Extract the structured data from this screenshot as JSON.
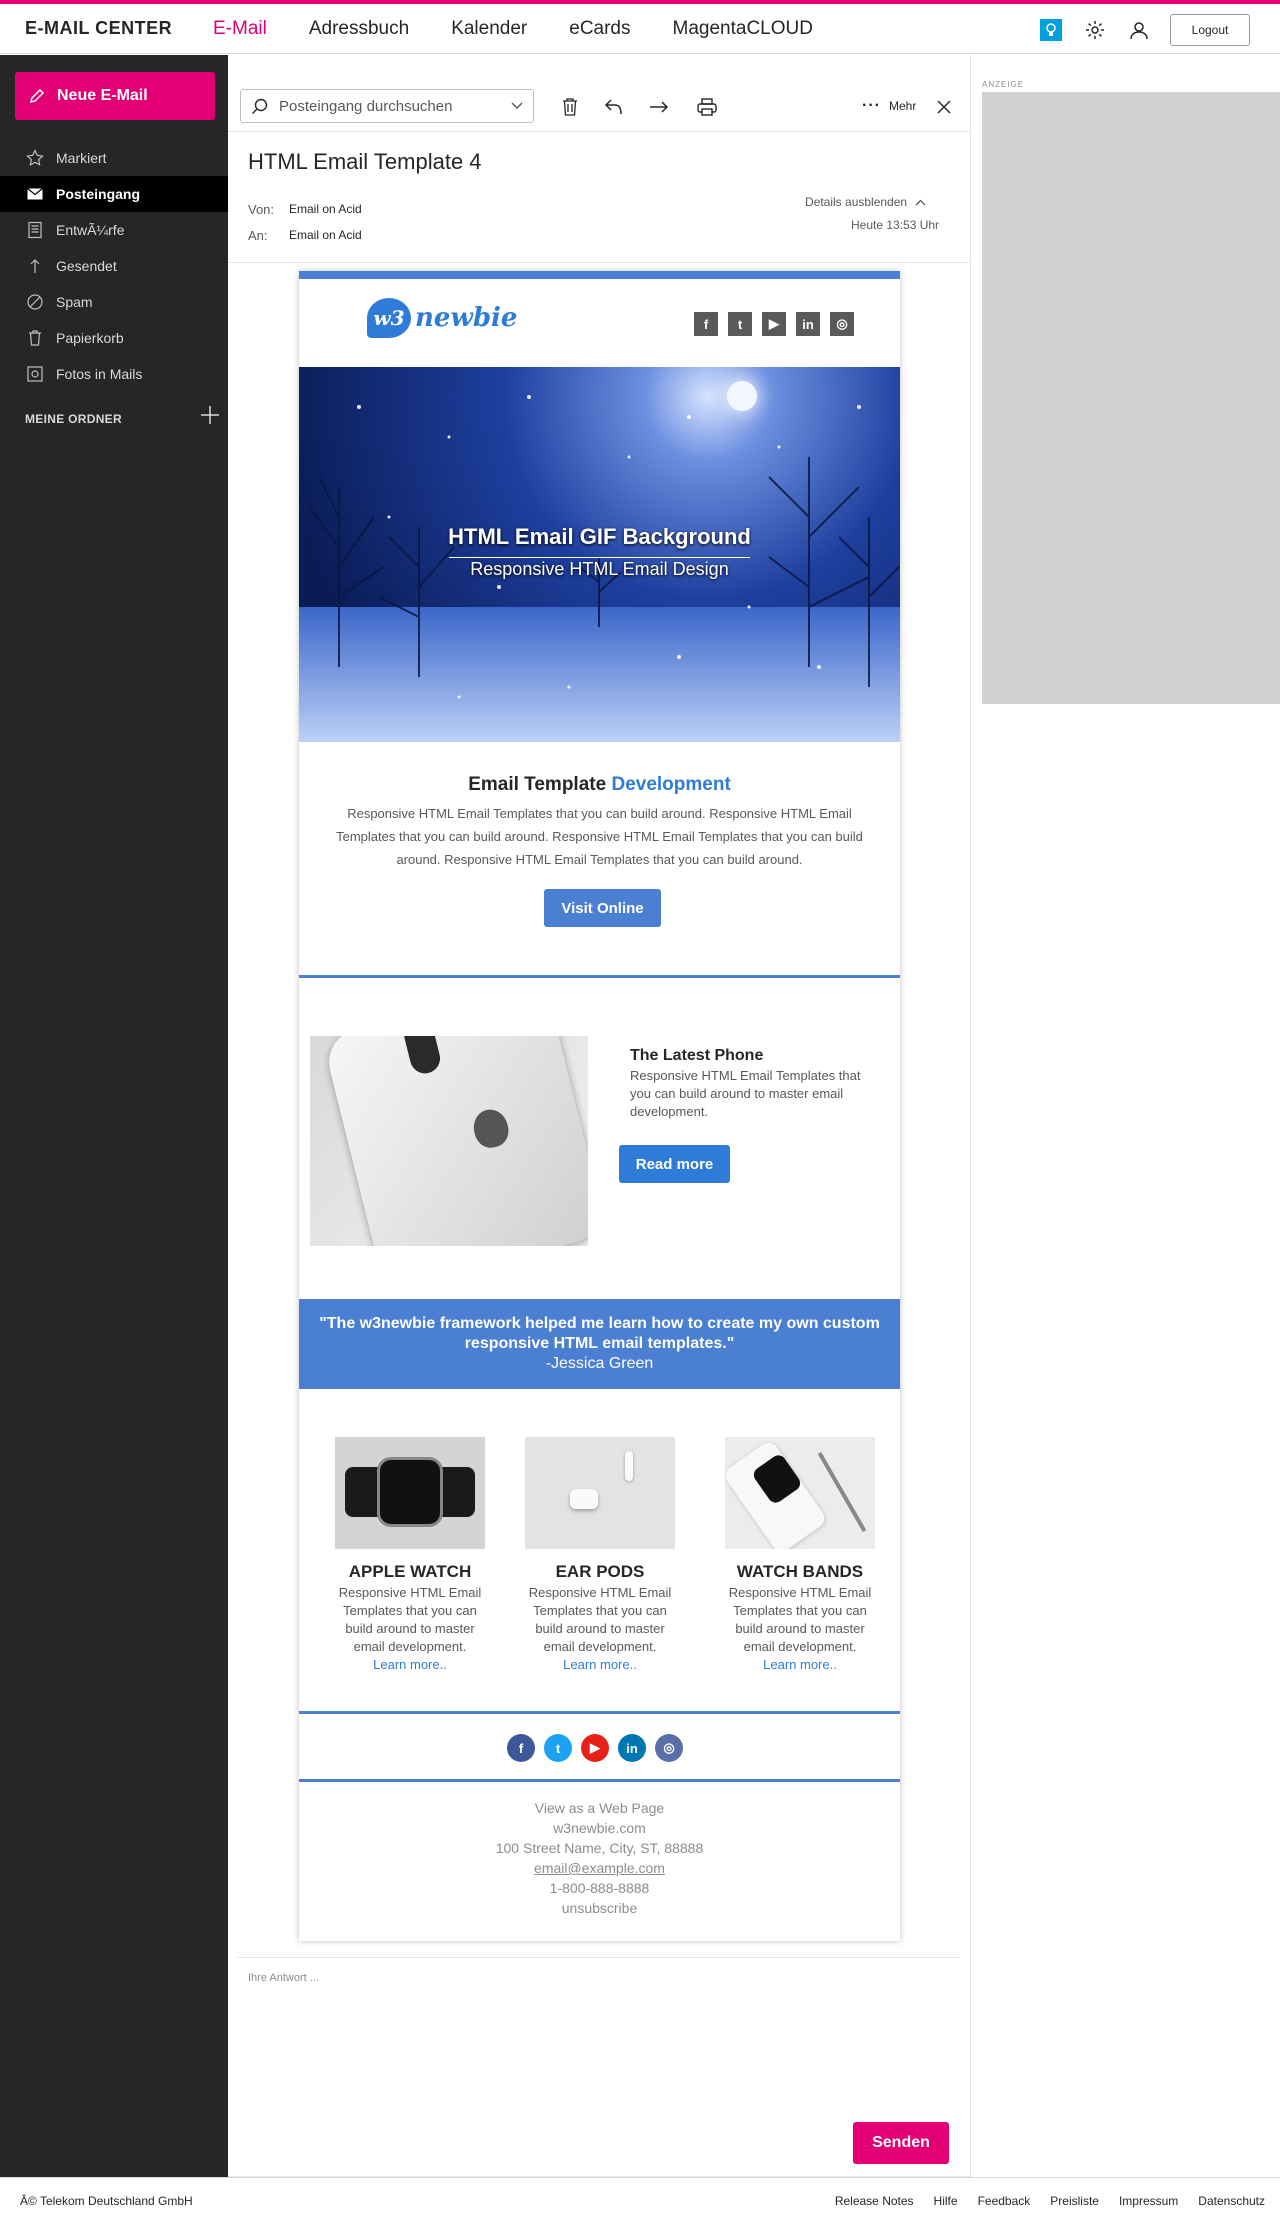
{
  "brand": "E-MAIL CENTER",
  "nav": [
    "E-Mail",
    "Adressbuch",
    "Kalender",
    "eCards",
    "MagentaCLOUD"
  ],
  "logout_label": "Logout",
  "new_mail_label": "Neue E-Mail",
  "sidebar": {
    "items": [
      {
        "label": "Markiert",
        "icon": "star-icon"
      },
      {
        "label": "Posteingang",
        "icon": "envelope-icon"
      },
      {
        "label": "EntwÃ¼rfe",
        "icon": "draft-icon"
      },
      {
        "label": "Gesendet",
        "icon": "upload-arrow-icon"
      },
      {
        "label": "Spam",
        "icon": "forbidden-icon"
      },
      {
        "label": "Papierkorb",
        "icon": "trash-icon"
      },
      {
        "label": "Fotos in Mails",
        "icon": "photo-icon"
      }
    ],
    "folders_label": "MEINE ORDNER"
  },
  "toolbar": {
    "search_placeholder": "Posteingang durchsuchen",
    "more_label": "Mehr"
  },
  "message": {
    "subject": "HTML Email Template 4",
    "from_label": "Von:",
    "from": "Email on Acid",
    "to_label": "An:",
    "to": "Email on Acid",
    "details_toggle": "Details ausblenden",
    "date": "Heute 13:53 Uhr"
  },
  "ad_label": "ANZEIGE",
  "email": {
    "logo_badge": "w3",
    "logo_text": "newbie",
    "social_top": [
      "f",
      "t",
      "▶",
      "in",
      "◎"
    ],
    "hero_title": "HTML Email GIF Background",
    "hero_subtitle": "Responsive HTML Email Design",
    "section_title_a": "Email Template ",
    "section_title_b": "Development",
    "section_text": "Responsive HTML Email Templates that you can build around. Responsive HTML Email Templates that you can build around. Responsive HTML Email Templates that you can build around. Responsive HTML Email Templates that you can build around.",
    "visit_label": "Visit Online",
    "latest_title": "The Latest Phone",
    "latest_text": "Responsive HTML Email Templates that you can build around to master email development.",
    "read_more_label": "Read more",
    "quote_text": "\"The w3newbie framework helped me learn how to create my own custom responsive HTML email templates.\"",
    "quote_author": "-Jessica Green",
    "products": [
      {
        "name": "APPLE WATCH",
        "text": "Responsive HTML Email Templates that you can build around to master email development.",
        "link": "Learn more.."
      },
      {
        "name": "EAR PODS",
        "text": "Responsive HTML Email Templates that you can build around to master email development.",
        "link": "Learn more.."
      },
      {
        "name": "WATCH BANDS",
        "text": "Responsive HTML Email Templates that you can build around to master email development.",
        "link": "Learn more.."
      }
    ],
    "social_bottom": [
      {
        "label": "f",
        "color": "#3b5998"
      },
      {
        "label": "t",
        "color": "#1da1f2"
      },
      {
        "label": "▶",
        "color": "#e62117"
      },
      {
        "label": "in",
        "color": "#0077b5"
      },
      {
        "label": "◎",
        "color": "#5a6fa8"
      }
    ],
    "footer": {
      "view_web": "View as a Web Page",
      "site": "w3newbie.com",
      "address": "100 Street Name, City, ST, 88888",
      "email": "email@example.com",
      "phone": "1-800-888-8888",
      "unsubscribe": "unsubscribe"
    }
  },
  "reply_placeholder": "Ihre Antwort ...",
  "send_label": "Senden",
  "footer": {
    "copyright": "Â© Telekom Deutschland GmbH",
    "links": [
      "Release Notes",
      "Hilfe",
      "Feedback",
      "Preisliste",
      "Impressum",
      "Datenschutz"
    ]
  },
  "colors": {
    "brand": "#e20074",
    "email_blue": "#4a7fd2",
    "sidebar": "#262626"
  }
}
